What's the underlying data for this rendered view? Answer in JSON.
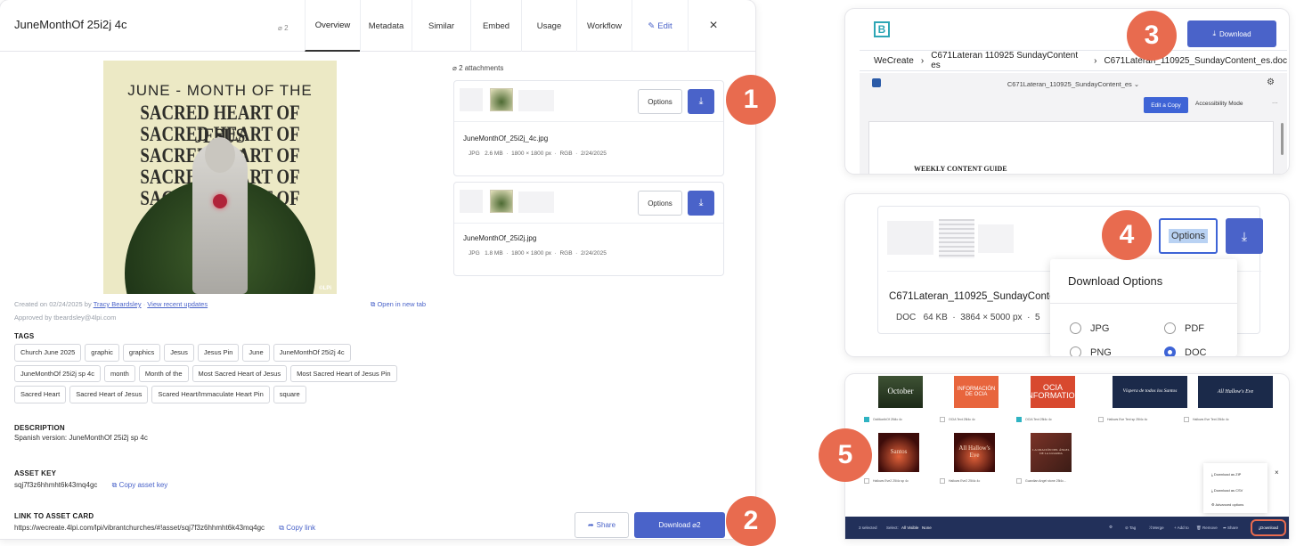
{
  "main": {
    "title": "JuneMonthOf 25i2j 4c",
    "attach_count": "2",
    "tabs": [
      "Overview",
      "Metadata",
      "Similar",
      "Embed",
      "Usage",
      "Workflow",
      "Edit"
    ],
    "close": "×",
    "hero": {
      "line1": "JUNE - MONTH OF THE",
      "lines": [
        "SACRED HEART OF JESUS",
        "SACRED HEART OF JESUS",
        "SACRED HEART OF JESUS",
        "SACRED HEART OF JESUS",
        "SACRED HEART OF JESUS"
      ],
      "watermark": "©LPi"
    },
    "created_prefix": "Created on 02/24/2025 by",
    "created_by": "Tracy Beardsley",
    "sep": "·",
    "view_updates": "View recent updates",
    "approved": "Approved by tbeardsley@4lpi.com",
    "open_new_tab": "Open in new tab",
    "tags_heading": "TAGS",
    "tags": [
      "Church June 2025",
      "graphic",
      "graphics",
      "Jesus",
      "Jesus Pin",
      "June",
      "JuneMonthOf 25i2j 4c",
      "JuneMonthOf 25i2j sp 4c",
      "month",
      "Month of the",
      "Most Sacred Heart of Jesus",
      "Most Sacred Heart of Jesus Pin",
      "Sacred Heart",
      "Sacred Heart of Jesus",
      "Scared Heart/Immaculate Heart Pin",
      "square"
    ],
    "description_heading": "DESCRIPTION",
    "description": "Spanish version: JuneMonthOf 25i2j sp 4c",
    "asset_key_heading": "ASSET KEY",
    "asset_key": "sqj7f3z6hhmht6k43mq4gc",
    "copy_asset_key": "Copy asset key",
    "link_heading": "LINK TO ASSET CARD",
    "link": "https://wecreate.4lpi.com/lpi/vibrantchurches/#!asset/sqj7f3z6hhmht6k43mq4gc",
    "copy_link": "Copy link",
    "attachments_label": "2 attachments",
    "attachments": [
      {
        "name": "JuneMonthOf_25i2j_4c.jpg",
        "type": "JPG",
        "size": "2.6 MB",
        "dims": "1800 × 1800 px",
        "color": "RGB",
        "date": "2/24/2025"
      },
      {
        "name": "JuneMonthOf_25i2j.jpg",
        "type": "JPG",
        "size": "1.8 MB",
        "dims": "1800 × 1800 px",
        "color": "RGB",
        "date": "2/24/2025"
      }
    ],
    "options_label": "Options",
    "share_label": "Share",
    "download_label": "Download",
    "download_count": "2"
  },
  "callouts": [
    "1",
    "2",
    "3",
    "4",
    "5"
  ],
  "p3": {
    "logo": "B",
    "download": "Download",
    "breadcrumb": [
      "WeCreate",
      "C671Lateran 110925 SundayContent es",
      "C671Lateran_110925_SundayContent_es.doc"
    ],
    "doc_name": "C671Lateran_110925_SundayContent_es",
    "edit_copy": "Edit a Copy",
    "accessibility": "Accessibility Mode",
    "more": "···",
    "doc_heading": "WEEKLY CONTENT GUIDE"
  },
  "p4": {
    "options": "Options",
    "filename": "C671Lateran_110925_SundayConten",
    "meta": {
      "type": "DOC",
      "size": "64 KB",
      "dims": "3864 × 5000 px",
      "extra": "5"
    },
    "dropdown_title": "Download Options",
    "formats": [
      {
        "label": "JPG",
        "selected": false
      },
      {
        "label": "PDF",
        "selected": false
      },
      {
        "label": "PNG",
        "selected": false
      },
      {
        "label": "DOC",
        "selected": true
      }
    ]
  },
  "p5": {
    "row1": [
      {
        "art": "October",
        "label": "OctMonthOf 25i4c 4c",
        "checked": true
      },
      {
        "art": "INFORMACIÓN DE OCIA",
        "label": "OCIA Text 25i4c 4c",
        "checked": false
      },
      {
        "art": "OCIA INFORMATION",
        "label": "OCIA Text 25i4c 4c",
        "checked": true
      },
      {
        "art": "Víspera de todos los Santos",
        "label": "Hallows Eve Text sp 25i4c 4c",
        "checked": false
      },
      {
        "art": "All Hallow's Eve",
        "label": "Hallows Eve Text 25i4c 4c",
        "checked": false
      }
    ],
    "row2": [
      {
        "art": "Santos",
        "label": "Hallows Eve2 25i4c sp 4c"
      },
      {
        "art": "All Hallow's Eve",
        "label": "Hallows Eve2 25i4c 4c"
      },
      {
        "art": "LA ORACIÓN DEL ÁNGEL DE LA GUARDA",
        "label": "Guardian Angel stone 25i4c..."
      }
    ],
    "menu": [
      "Download as ZIP",
      "Download as CSV",
      "Advanced options"
    ],
    "close": "×",
    "bottom": {
      "selected": "3 selected",
      "select_label": "Select:",
      "all_visible": "All Visible",
      "none": "None",
      "actions": [
        "Tag",
        "Merge",
        "Add to",
        "Remove",
        "Share",
        "Download"
      ]
    }
  },
  "colors": {
    "accent": "#4a63c9",
    "callout": "#e86b4f",
    "dark_bar": "#22305a"
  }
}
